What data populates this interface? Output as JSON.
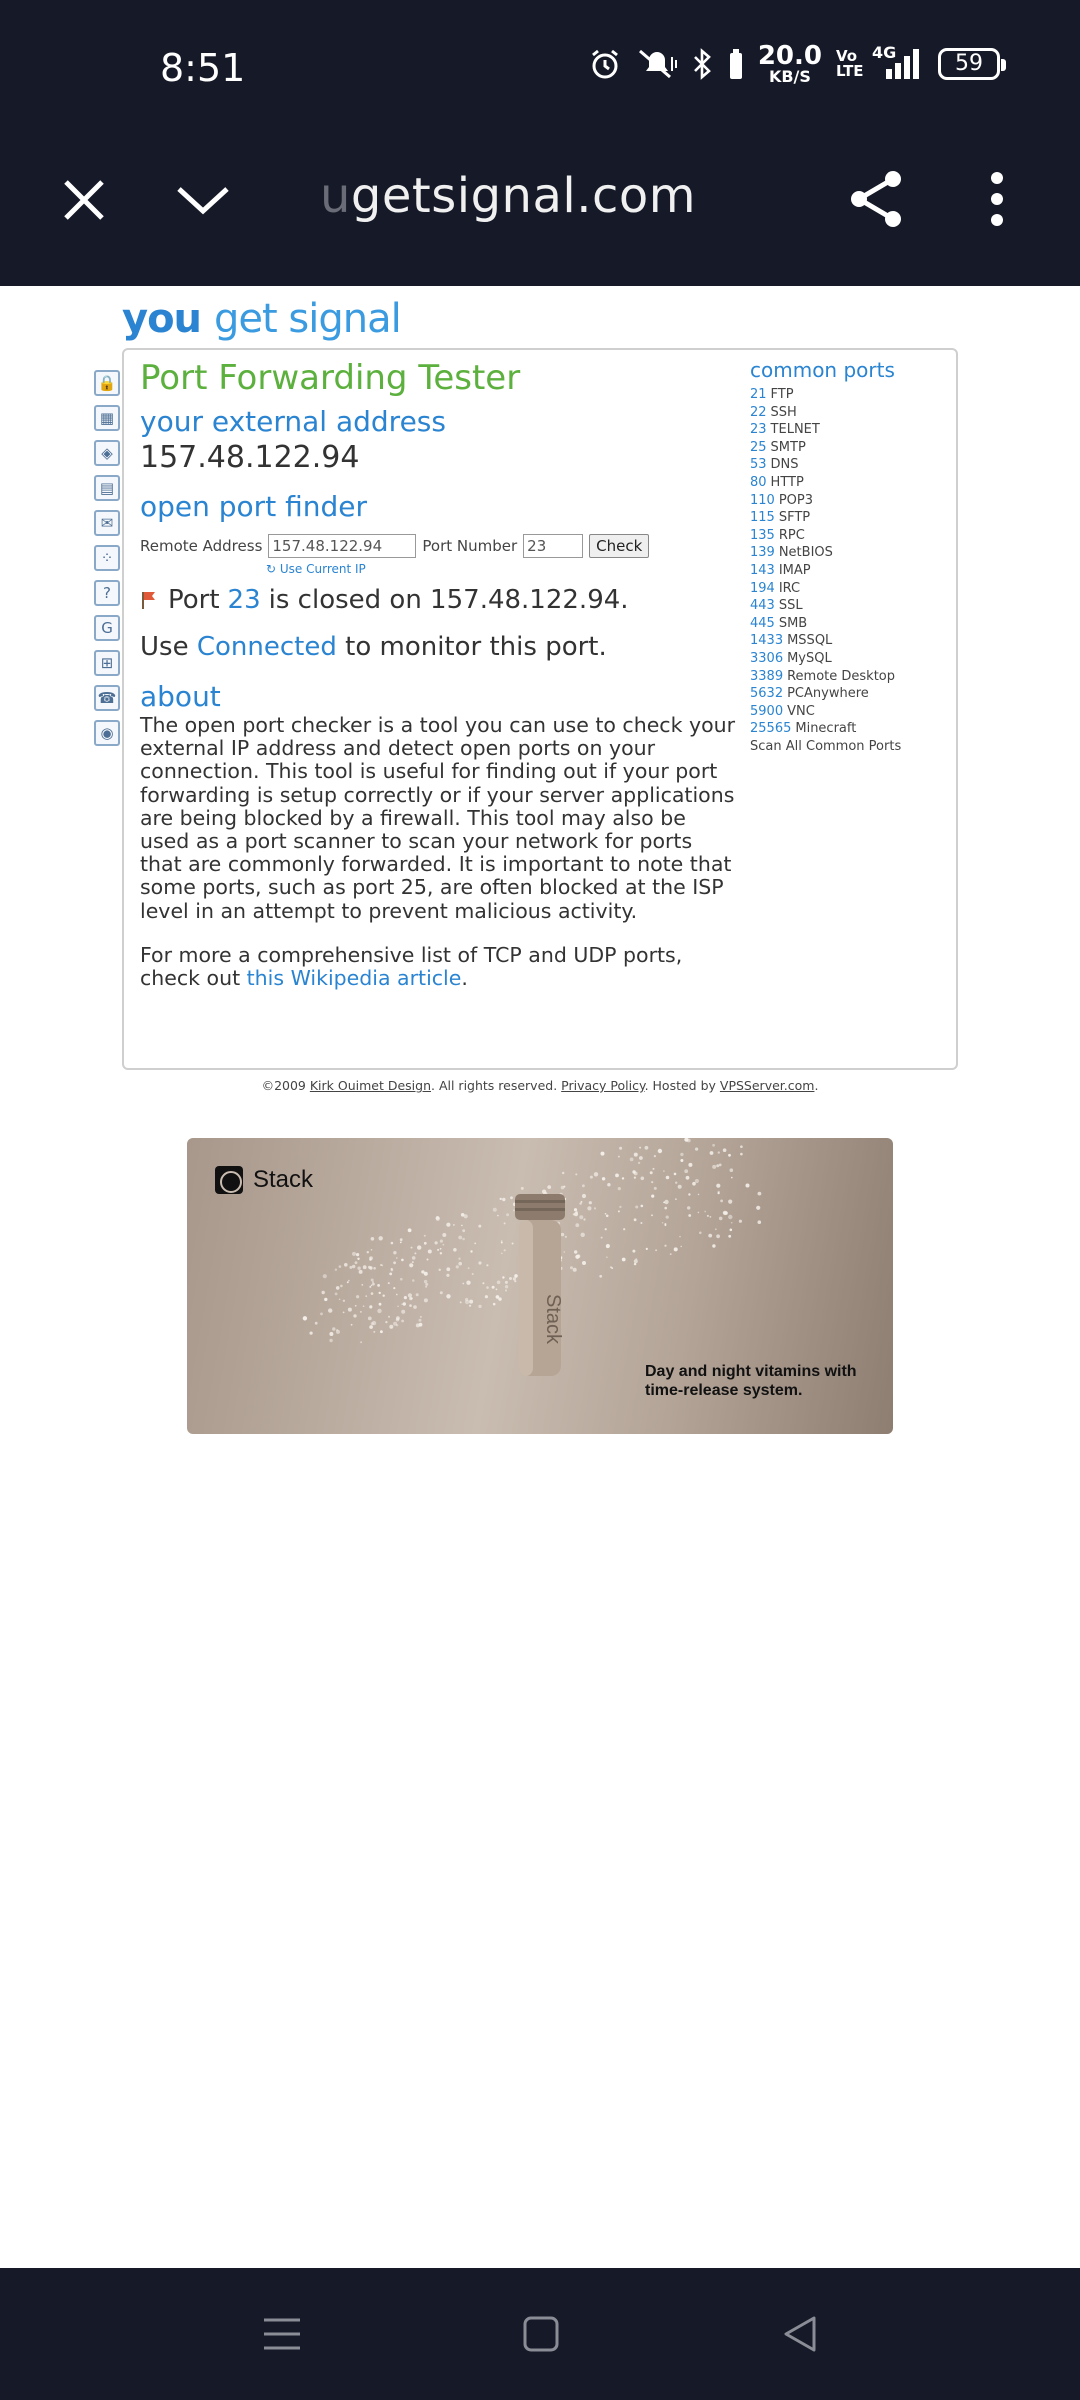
{
  "status_bar": {
    "time": "8:51",
    "net_speed_value": "20.0",
    "net_speed_unit": "KB/S",
    "volte": "Vo LTE",
    "network": "4G",
    "battery": "59"
  },
  "browser": {
    "url_faded": "u",
    "url": "getsignal.com"
  },
  "site": {
    "logo_you": "you",
    "logo_rest": "get signal"
  },
  "page": {
    "title": "Port Forwarding Tester",
    "external_heading": "your external address",
    "external_ip": "157.48.122.94",
    "finder_heading": "open port finder",
    "remote_label": "Remote Address",
    "remote_value": "157.48.122.94",
    "port_label": "Port Number",
    "port_value": "23",
    "check_button": "Check",
    "use_current_ip": "Use Current IP",
    "result_prefix": "Port",
    "result_port": "23",
    "result_suffix": "is closed on 157.48.122.94.",
    "monitor_prefix": "Use",
    "monitor_link": "Connected",
    "monitor_suffix": "to monitor this port.",
    "about_heading": "about",
    "about_text": "The open port checker is a tool you can use to check your external IP address and detect open ports on your connection. This tool is useful for finding out if your port forwarding is setup correctly or if your server applications are being blocked by a firewall. This tool may also be used as a port scanner to scan your network for ports that are commonly forwarded. It is important to note that some ports, such as port 25, are often blocked at the ISP level in an attempt to prevent malicious activity.",
    "more_text_prefix": "For more a comprehensive list of TCP and UDP ports, check out",
    "more_text_link": "this Wikipedia article",
    "more_text_suffix": "."
  },
  "common_ports": {
    "title": "common ports",
    "items": [
      {
        "num": "21",
        "name": "FTP"
      },
      {
        "num": "22",
        "name": "SSH"
      },
      {
        "num": "23",
        "name": "TELNET"
      },
      {
        "num": "25",
        "name": "SMTP"
      },
      {
        "num": "53",
        "name": "DNS"
      },
      {
        "num": "80",
        "name": "HTTP"
      },
      {
        "num": "110",
        "name": "POP3"
      },
      {
        "num": "115",
        "name": "SFTP"
      },
      {
        "num": "135",
        "name": "RPC"
      },
      {
        "num": "139",
        "name": "NetBIOS"
      },
      {
        "num": "143",
        "name": "IMAP"
      },
      {
        "num": "194",
        "name": "IRC"
      },
      {
        "num": "443",
        "name": "SSL"
      },
      {
        "num": "445",
        "name": "SMB"
      },
      {
        "num": "1433",
        "name": "MSSQL"
      },
      {
        "num": "3306",
        "name": "MySQL"
      },
      {
        "num": "3389",
        "name": "Remote Desktop"
      },
      {
        "num": "5632",
        "name": "PCAnywhere"
      },
      {
        "num": "5900",
        "name": "VNC"
      },
      {
        "num": "25565",
        "name": "Minecraft"
      }
    ],
    "scan_all": "Scan All Common Ports"
  },
  "footer": {
    "copyright": "©2009",
    "author": "Kirk Ouimet Design",
    "rights": ". All rights reserved.",
    "privacy": "Privacy Policy",
    "hosted": ". Hosted by",
    "host": "VPSServer.com",
    "end": "."
  },
  "ad": {
    "brand": "Stack",
    "bottle_label": "Stack",
    "tagline_line1": "Day and night vitamins with",
    "tagline_line2": "time-release system."
  },
  "colors": {
    "bar_bg": "#161a28",
    "title_green": "#5cb03d",
    "link_blue": "#2a84d1"
  }
}
